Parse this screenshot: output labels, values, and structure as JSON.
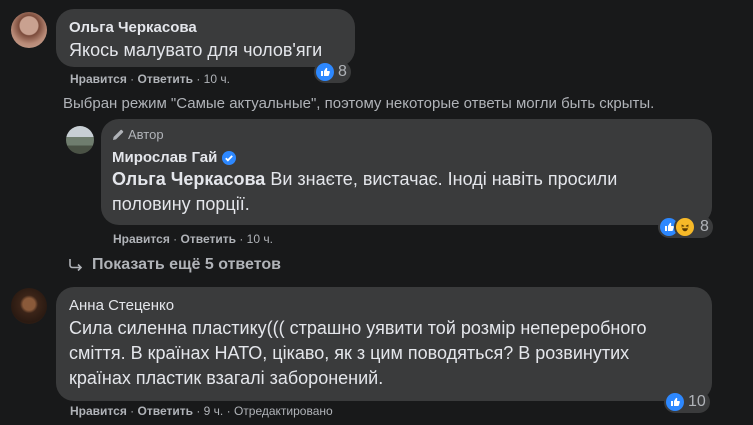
{
  "comments": [
    {
      "author": "Ольга Черкасова",
      "text": "Якось малувато для чолов'яги",
      "actions": {
        "like": "Нравится",
        "reply": "Ответить",
        "time": "10 ч."
      },
      "reactions": {
        "count": "8"
      }
    },
    {
      "author": "Анна Стеценко",
      "text_lines": [
        "Сила силенна пластику((( страшно уявити той розмір непереробного",
        "сміття. В країнах НАТО, цікаво, як з цим поводяться? В розвинутих",
        "країнах пластик взагалі заборонений."
      ],
      "actions": {
        "like": "Нравится",
        "reply": "Ответить",
        "time": "9 ч.",
        "edited": "Отредактировано"
      },
      "reactions": {
        "count": "10"
      }
    }
  ],
  "notice": "Выбран режим \"Самые актуальные\", поэтому некоторые ответы могли быть скрыты.",
  "reply": {
    "badge": "Автор",
    "author": "Мирослав Гай",
    "mention": "Ольга Черкасова",
    "text_line1": "Ви знаєте, вистачає. Іноді навіть просили",
    "text_line2": "половину порції.",
    "actions": {
      "like": "Нравится",
      "reply": "Ответить",
      "time": "10 ч."
    },
    "reactions": {
      "count": "8"
    }
  },
  "show_more": "Показать ещё 5 ответов",
  "sep": "·",
  "colors": {
    "like": "#2d88ff",
    "haha": "#f7b928",
    "verified": "#2d88ff"
  },
  "icons": [
    "like-icon",
    "haha-icon",
    "pencil-icon",
    "verified-icon",
    "reply-arrow-icon"
  ]
}
